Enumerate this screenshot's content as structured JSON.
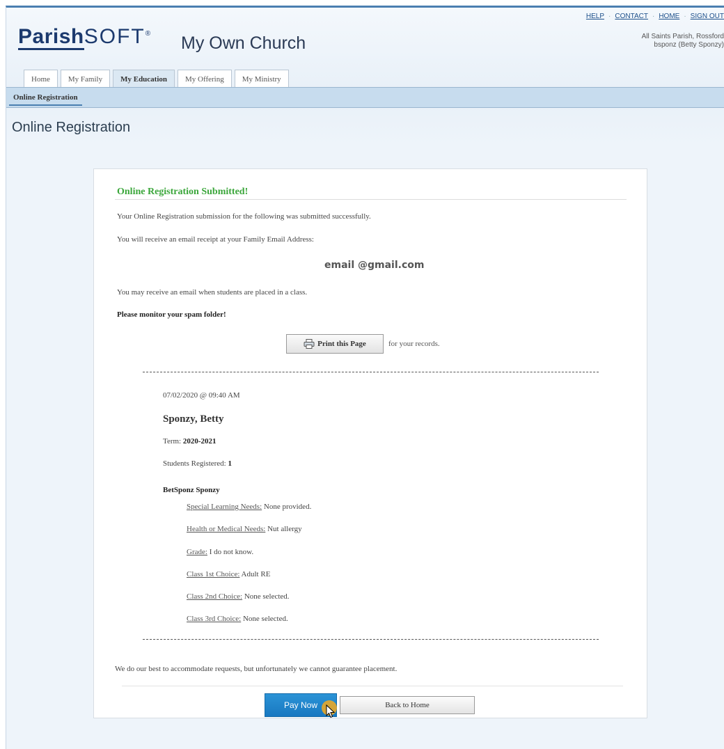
{
  "header": {
    "logo_bold": "Parish",
    "logo_light": "SOFT",
    "church_name": "My Own Church",
    "links": [
      "HELP",
      "CONTACT",
      "HOME",
      "SIGN OUT"
    ],
    "parish_line": "All Saints Parish, Rossford",
    "user_line": "bsponz (Betty Sponzy)"
  },
  "tabs": [
    {
      "label": "Home"
    },
    {
      "label": "My Family"
    },
    {
      "label": "My Education"
    },
    {
      "label": "My Offering"
    },
    {
      "label": "My Ministry"
    }
  ],
  "subnav": {
    "label": "Online Registration"
  },
  "page_title": "Online Registration",
  "confirmation": {
    "heading": "Online Registration Submitted!",
    "line1": "Your Online Registration submission for the following was submitted successfully.",
    "line2": "You will receive an email receipt at your Family Email Address:",
    "email": "email @gmail.com",
    "line3": "You may receive an email when students are placed in a class.",
    "spam_warning": "Please monitor your spam folder!",
    "print_label": "Print this Page",
    "print_note": "for your records."
  },
  "record": {
    "timestamp": "07/02/2020 @ 09:40 AM",
    "family_name": "Sponzy, Betty",
    "term_label": "Term:",
    "term_value": "2020-2021",
    "students_label": "Students Registered:",
    "students_value": "1",
    "student_name": "BetSponz Sponzy",
    "fields": [
      {
        "label": "Special Learning Needs:",
        "value": "None provided."
      },
      {
        "label": "Health or Medical Needs:",
        "value": "Nut allergy"
      },
      {
        "label": "Grade:",
        "value": "I do not know."
      },
      {
        "label": "Class 1st Choice:",
        "value": "Adult RE"
      },
      {
        "label": "Class 2nd Choice:",
        "value": "None selected."
      },
      {
        "label": "Class 3rd Choice:",
        "value": "None selected."
      }
    ]
  },
  "disclaimer": "We do our best to accommodate requests, but unfortunately we cannot guarantee placement.",
  "actions": {
    "pay_label": "Pay Now",
    "back_label": "Back to Home"
  },
  "colors": {
    "success": "#3aa63a",
    "primary_button": "#1f86cc",
    "brand": "#1c3a6e"
  }
}
